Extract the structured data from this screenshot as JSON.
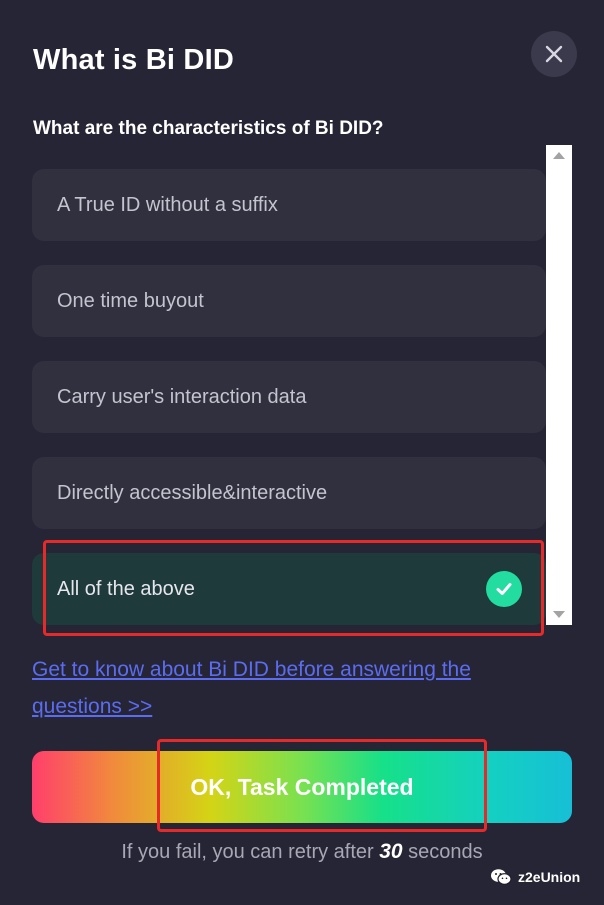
{
  "dialog": {
    "title": "What is Bi DID",
    "question": "What are the characteristics of Bi DID?",
    "options": [
      {
        "label": "A True ID without a suffix",
        "selected": false
      },
      {
        "label": "One time buyout",
        "selected": false
      },
      {
        "label": "Carry user's interaction data",
        "selected": false
      },
      {
        "label": "Directly accessible&interactive",
        "selected": false
      },
      {
        "label": "All of the above",
        "selected": true
      }
    ],
    "link_line1": "Get to know about Bi DID before answering the",
    "link_line2": "questions >>",
    "ok_label": "OK, Task Completed",
    "retry_prefix": "If you fail, you can retry after ",
    "retry_seconds": "30",
    "retry_suffix": " seconds"
  },
  "watermark": {
    "text": "z2eUnion",
    "icon": "wechat-icon"
  },
  "colors": {
    "background": "#262535",
    "option_bg": "#30303f",
    "selected_bg": "#1f3a3a",
    "check": "#22dca0",
    "link": "#5b6cf0",
    "highlight": "#e62a2a"
  },
  "icons": {
    "close": "close-icon",
    "check": "check-circle-icon"
  }
}
